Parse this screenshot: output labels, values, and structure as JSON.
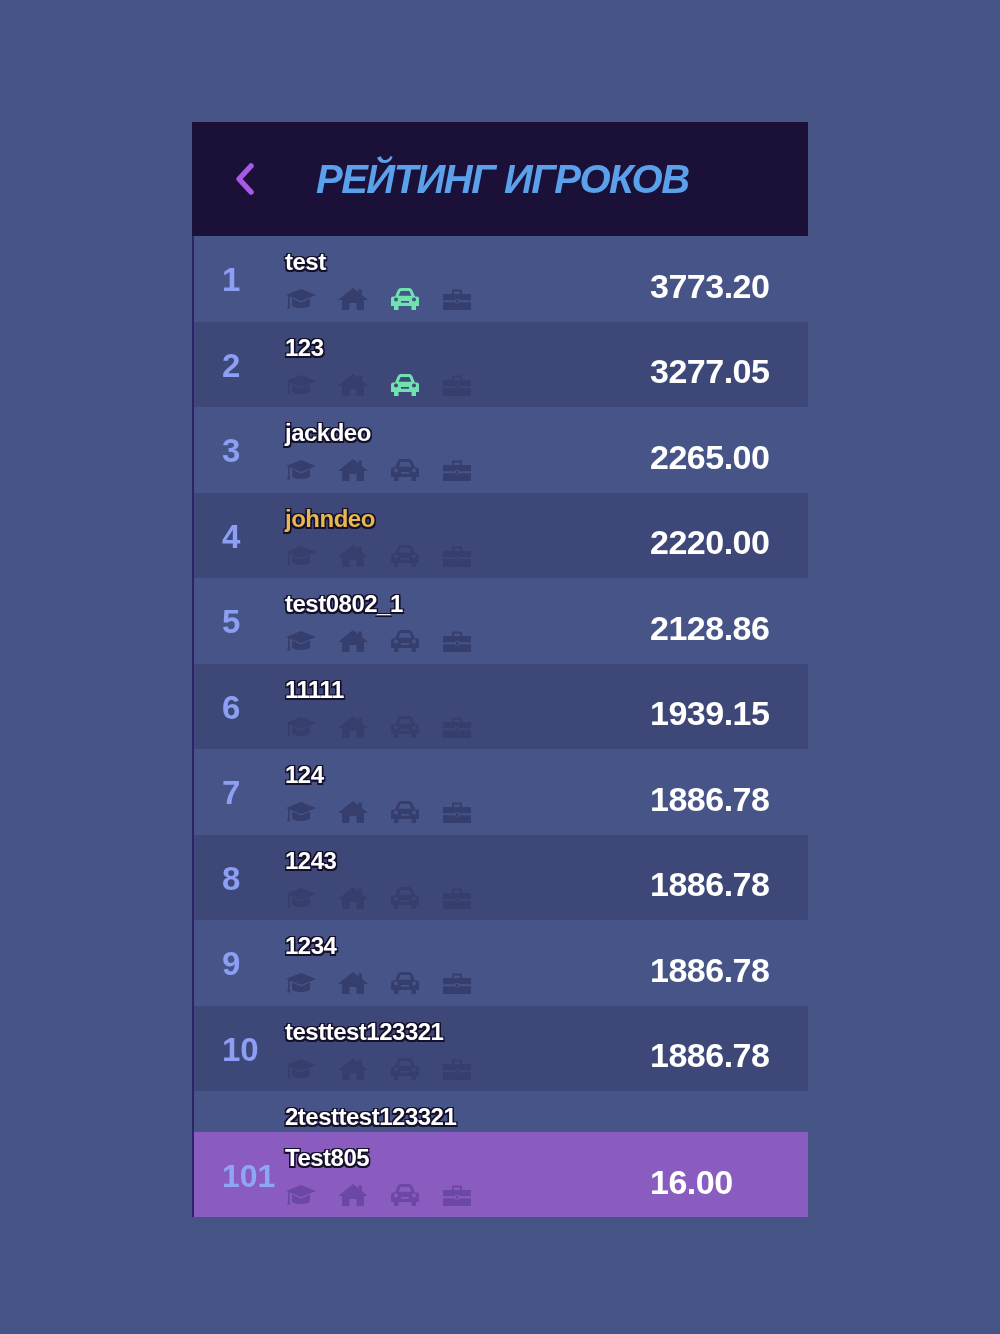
{
  "header": {
    "title": "РЕЙТИНГ ИГРОКОВ"
  },
  "players": [
    {
      "rank": "1",
      "name": "test",
      "highlighted": false,
      "score": "3773.20",
      "badges": [
        {
          "kind": "education",
          "on": false
        },
        {
          "kind": "home",
          "on": false
        },
        {
          "kind": "car",
          "on": true
        },
        {
          "kind": "job",
          "on": false
        }
      ]
    },
    {
      "rank": "2",
      "name": "123",
      "highlighted": false,
      "score": "3277.05",
      "badges": [
        {
          "kind": "education",
          "on": false
        },
        {
          "kind": "home",
          "on": false
        },
        {
          "kind": "car",
          "on": true
        },
        {
          "kind": "job",
          "on": false
        }
      ]
    },
    {
      "rank": "3",
      "name": "jackdeo",
      "highlighted": false,
      "score": "2265.00",
      "badges": [
        {
          "kind": "education",
          "on": false
        },
        {
          "kind": "home",
          "on": false
        },
        {
          "kind": "car",
          "on": false
        },
        {
          "kind": "job",
          "on": false
        }
      ]
    },
    {
      "rank": "4",
      "name": "johndeo",
      "highlighted": true,
      "score": "2220.00",
      "badges": [
        {
          "kind": "education",
          "on": false
        },
        {
          "kind": "home",
          "on": false
        },
        {
          "kind": "car",
          "on": false
        },
        {
          "kind": "job",
          "on": false
        }
      ]
    },
    {
      "rank": "5",
      "name": "test0802_1",
      "highlighted": false,
      "score": "2128.86",
      "badges": [
        {
          "kind": "education",
          "on": false
        },
        {
          "kind": "home",
          "on": false
        },
        {
          "kind": "car",
          "on": false
        },
        {
          "kind": "job",
          "on": false
        }
      ]
    },
    {
      "rank": "6",
      "name": "11111",
      "highlighted": false,
      "score": "1939.15",
      "badges": [
        {
          "kind": "education",
          "on": false
        },
        {
          "kind": "home",
          "on": false
        },
        {
          "kind": "car",
          "on": false
        },
        {
          "kind": "job",
          "on": false
        }
      ]
    },
    {
      "rank": "7",
      "name": "124",
      "highlighted": false,
      "score": "1886.78",
      "badges": [
        {
          "kind": "education",
          "on": false
        },
        {
          "kind": "home",
          "on": false
        },
        {
          "kind": "car",
          "on": false
        },
        {
          "kind": "job",
          "on": false
        }
      ]
    },
    {
      "rank": "8",
      "name": "1243",
      "highlighted": false,
      "score": "1886.78",
      "badges": [
        {
          "kind": "education",
          "on": false
        },
        {
          "kind": "home",
          "on": false
        },
        {
          "kind": "car",
          "on": false
        },
        {
          "kind": "job",
          "on": false
        }
      ]
    },
    {
      "rank": "9",
      "name": "1234",
      "highlighted": false,
      "score": "1886.78",
      "badges": [
        {
          "kind": "education",
          "on": false
        },
        {
          "kind": "home",
          "on": false
        },
        {
          "kind": "car",
          "on": false
        },
        {
          "kind": "job",
          "on": false
        }
      ]
    },
    {
      "rank": "10",
      "name": "testtest123321",
      "highlighted": false,
      "score": "1886.78",
      "badges": [
        {
          "kind": "education",
          "on": false
        },
        {
          "kind": "home",
          "on": false
        },
        {
          "kind": "car",
          "on": false
        },
        {
          "kind": "job",
          "on": false
        }
      ]
    },
    {
      "name": "2testtest123321",
      "highlighted": false
    }
  ],
  "current_player": {
    "rank": "101",
    "name": "Test805",
    "highlighted": false,
    "score": "16.00",
    "badges": [
      {
        "kind": "education",
        "on": false
      },
      {
        "kind": "home",
        "on": false
      },
      {
        "kind": "car",
        "on": false
      },
      {
        "kind": "job",
        "on": false
      }
    ]
  }
}
